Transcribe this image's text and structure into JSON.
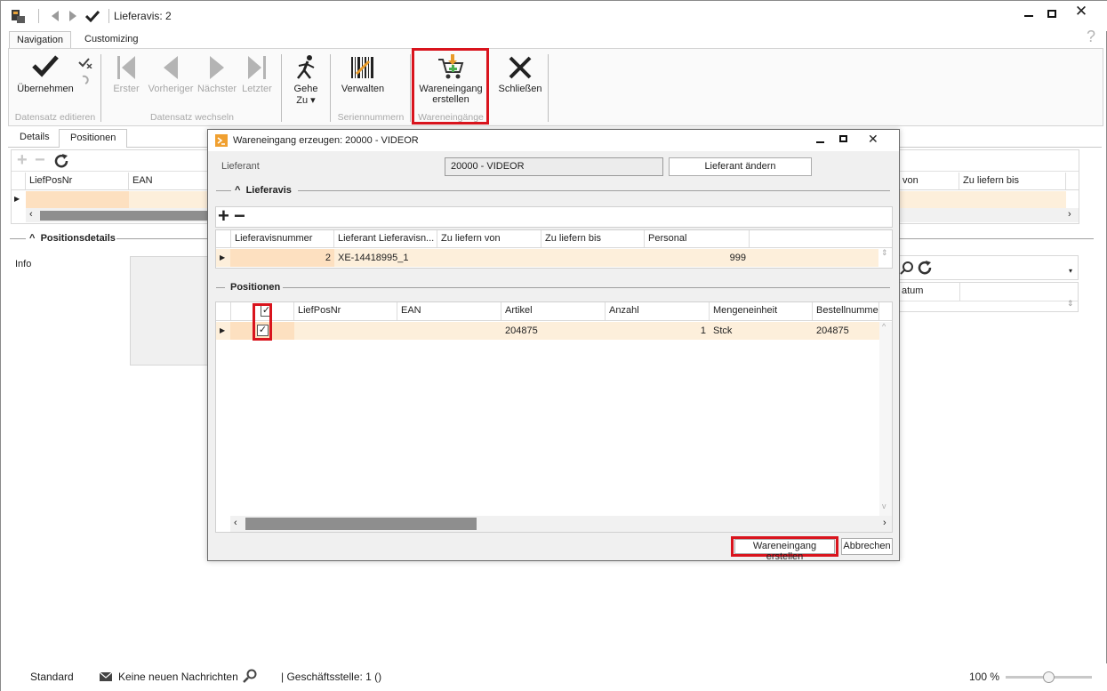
{
  "window": {
    "title": "Lieferavis: 2"
  },
  "ribbon": {
    "tabs": [
      "Navigation",
      "Customizing"
    ],
    "help": "?",
    "buttons": {
      "apply": "Übernehmen",
      "first": "Erster",
      "prev": "Vorheriger",
      "next": "Nächster",
      "last": "Letzter",
      "goto_line1": "Gehe",
      "goto_line2": "Zu ▾",
      "manage": "Verwalten",
      "create_receipt_line1": "Wareneingang",
      "create_receipt_line2": "erstellen",
      "close": "Schließen"
    },
    "groups": {
      "edit": "Datensatz editieren",
      "switch": "Datensatz wechseln",
      "serial": "Seriennummern",
      "receipts": "Wareneingänge"
    }
  },
  "main": {
    "tabs": [
      "Details",
      "Positionen"
    ],
    "grid": {
      "headers": [
        "LiefPosNr",
        "EAN",
        "von",
        "Zu liefern bis"
      ]
    },
    "details_section": "Positionsdetails",
    "info_label": "Info",
    "right_grid_header": "atum"
  },
  "dialog": {
    "title": "Wareneingang erzeugen: 20000 - VIDEOR",
    "supplier_label": "Lieferant",
    "supplier_value": "20000 - VIDEOR",
    "change_supplier": "Lieferant ändern",
    "lieferavis_section": "Lieferavis",
    "lieferavis_grid": {
      "headers": [
        "Lieferavisnummer",
        "Lieferant Lieferavisn...",
        "Zu liefern von",
        "Zu liefern bis",
        "Personal"
      ],
      "rows": [
        [
          "2",
          "XE-14418995_1",
          "",
          "",
          "999"
        ]
      ]
    },
    "positions_section": "Positionen",
    "positions_grid": {
      "headers": [
        "LiefPosNr",
        "EAN",
        "Artikel",
        "Anzahl",
        "Mengeneinheit",
        "Bestellnumme"
      ],
      "rows": [
        [
          "",
          "",
          "204875",
          "1",
          "Stck",
          "204875"
        ]
      ]
    },
    "ok": "Wareneingang erstellen",
    "cancel": "Abbrechen"
  },
  "status": {
    "mode": "Standard",
    "messages": "Keine neuen Nachrichten",
    "branch": "| Geschäftsstelle:  1 ()",
    "zoom": "100 %",
    "zoom_level": 0.5
  },
  "colors": {
    "highlight": "#d9141d",
    "row_selected": "#fdefdb"
  }
}
